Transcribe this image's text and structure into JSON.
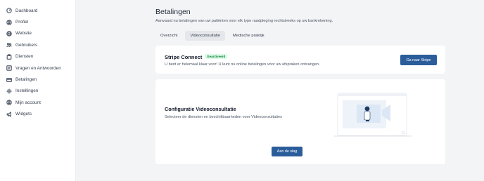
{
  "sidebar": {
    "items": [
      {
        "label": "Dashboard",
        "icon": "dashboard-icon"
      },
      {
        "label": "Profiel",
        "icon": "user-icon"
      },
      {
        "label": "Website",
        "icon": "globe-icon"
      },
      {
        "label": "Gebruikers",
        "icon": "users-icon"
      },
      {
        "label": "Diensten",
        "icon": "clipboard-icon"
      },
      {
        "label": "Vragen en Antwoorden",
        "icon": "qa-icon"
      },
      {
        "label": "Betalingen",
        "icon": "credit-card-icon"
      },
      {
        "label": "Instellingen",
        "icon": "gear-icon"
      },
      {
        "label": "Mijn account",
        "icon": "account-icon"
      },
      {
        "label": "Widgets",
        "icon": "megaphone-icon"
      }
    ]
  },
  "header": {
    "title": "Betalingen",
    "subtitle": "Aanvaard nu betalingen van uw patiënten voor elk type raadpleging rechtstreeks op uw bankrekening."
  },
  "tabs": [
    {
      "label": "Overzicht",
      "active": false
    },
    {
      "label": "Videoconsultatie",
      "active": true
    },
    {
      "label": "Medische praktijk",
      "active": false
    }
  ],
  "stripe_card": {
    "title": "Stripe Connect",
    "badge": "Geactiveerd",
    "description": "U bent er helemaal klaar voor! U kunt nu online betalingen voor uw afspraken ontvangen.",
    "button_label": "Ga naar Stripe"
  },
  "config_card": {
    "title": "Configuratie Videoconsultatie",
    "description": "Selecteer de diensten en beschikbaarheden voor Videoconsultaties",
    "button_label": "Aan de slag"
  },
  "colors": {
    "accent": "#2b5d9b",
    "badge_bg": "#dcfce7",
    "badge_text": "#15803d",
    "page_bg": "#f3f4f6"
  }
}
